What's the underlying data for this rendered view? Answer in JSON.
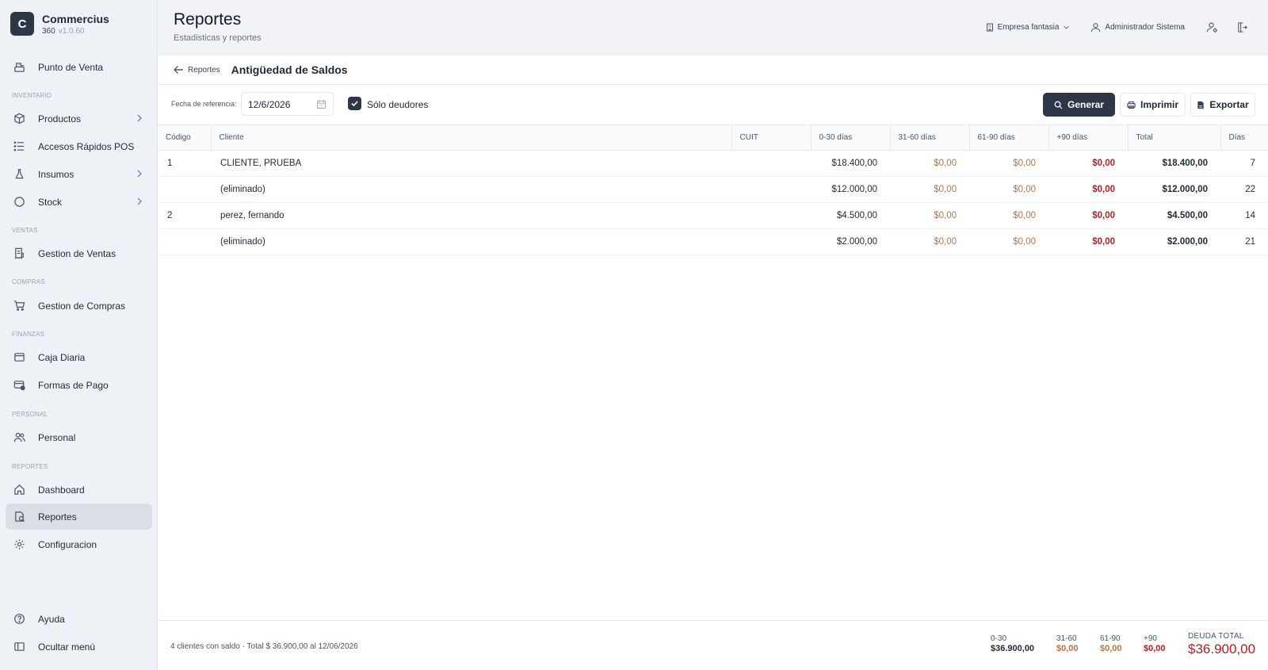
{
  "brand": {
    "logo_letter": "C",
    "name": "Commercius",
    "product": "360",
    "version": "v1.0.60"
  },
  "sidebar": {
    "point_of_sale": "Punto de Venta",
    "sections": {
      "inventario": "INVENTARIO",
      "ventas": "VENTAS",
      "compras": "COMPRAS",
      "finanzas": "FINANZAS",
      "personal": "PERSONAL",
      "reportes": "REPORTES"
    },
    "items": {
      "productos": "Productos",
      "accesos": "Accesos Rápidos POS",
      "insumos": "Insumos",
      "stock": "Stock",
      "gestion_ventas": "Gestion de Ventas",
      "gestion_compras": "Gestion de Compras",
      "caja": "Caja Diaria",
      "formas_pago": "Formas de Pago",
      "personal": "Personal",
      "dashboard": "Dashboard",
      "reportes": "Reportes",
      "configuracion": "Configuracion",
      "ayuda": "Ayuda",
      "ocultar": "Ocultar menú"
    }
  },
  "header": {
    "title": "Reportes",
    "subtitle": "Estadisticas y reportes",
    "company": "Empresa fantasia",
    "user": "Administrador Sistema"
  },
  "breadcrumb": {
    "back": "Reportes",
    "title": "Antigüedad de Saldos"
  },
  "filters": {
    "ref_date_label": "Fecha de referencia:",
    "ref_date_value": "12/6/2026",
    "only_debtors_label": "Sólo deudores",
    "only_debtors_checked": true,
    "generate": "Generar",
    "print": "Imprimir",
    "export": "Exportar"
  },
  "table": {
    "columns": [
      "Código",
      "Cliente",
      "CUIT",
      "0-30 días",
      "31-60 días",
      "61-90 días",
      "+90 días",
      "Total",
      "Días"
    ],
    "rows": [
      {
        "code": "1",
        "client": "CLIENTE, PRUEBA",
        "cuit": "",
        "d0_30": "$18.400,00",
        "d31_60": "$0,00",
        "d61_90": "$0,00",
        "d90": "$0,00",
        "total": "$18.400,00",
        "days": "7"
      },
      {
        "code": "",
        "client": "(eliminado)",
        "cuit": "",
        "d0_30": "$12.000,00",
        "d31_60": "$0,00",
        "d61_90": "$0,00",
        "d90": "$0,00",
        "total": "$12.000,00",
        "days": "22"
      },
      {
        "code": "2",
        "client": "perez, fernando",
        "cuit": "",
        "d0_30": "$4.500,00",
        "d31_60": "$0,00",
        "d61_90": "$0,00",
        "d90": "$0,00",
        "total": "$4.500,00",
        "days": "14"
      },
      {
        "code": "",
        "client": "(eliminado)",
        "cuit": "",
        "d0_30": "$2.000,00",
        "d31_60": "$0,00",
        "d61_90": "$0,00",
        "d90": "$0,00",
        "total": "$2.000,00",
        "days": "21"
      }
    ]
  },
  "footer": {
    "note": "4 clientes con saldo · Total $ 36.900,00 al 12/06/2026",
    "s0_30": {
      "label": "0-30",
      "value": "$36.900,00"
    },
    "s31_60": {
      "label": "31-60",
      "value": "$0,00"
    },
    "s61_90": {
      "label": "61-90",
      "value": "$0,00"
    },
    "s90": {
      "label": "+90",
      "value": "$0,00"
    },
    "total": {
      "label": "DEUDA TOTAL",
      "value": "$36.900,00"
    }
  },
  "colors": {
    "primary": "#2d3748",
    "orange": "#c2703d",
    "red": "#b91c1c",
    "active_bg": "#d9dee7"
  }
}
